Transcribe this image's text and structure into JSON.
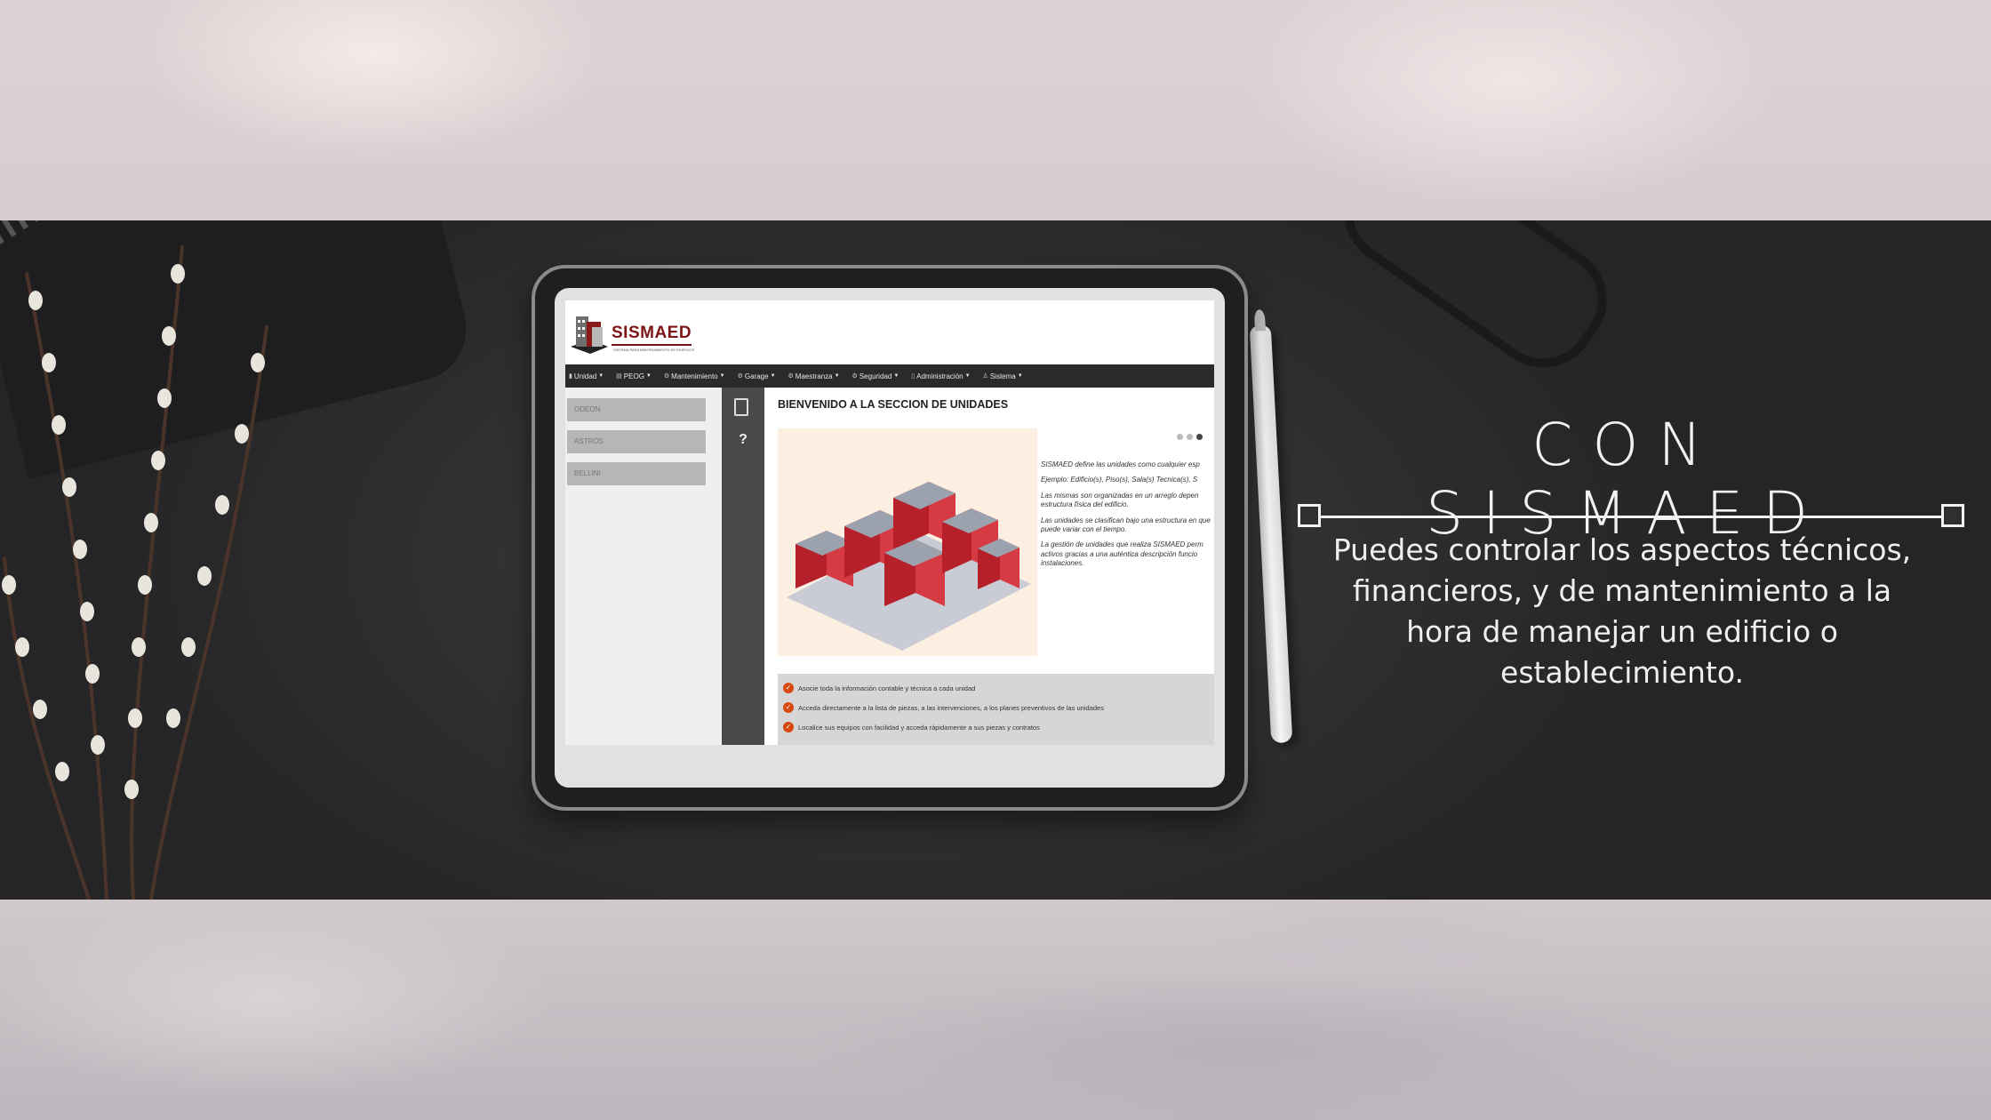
{
  "app": {
    "brand": "SISMAED",
    "brand_sub": "SISTEMA PARA MANTENIMIENTO DE EDIFICIOS",
    "menu": [
      {
        "label": "Unidad",
        "icon": "building-icon"
      },
      {
        "label": "PEOG",
        "icon": "table-icon"
      },
      {
        "label": "Mantenimiento",
        "icon": "gears-icon"
      },
      {
        "label": "Garage",
        "icon": "gears-icon"
      },
      {
        "label": "Maestranza",
        "icon": "gears-icon"
      },
      {
        "label": "Seguridad",
        "icon": "gears-icon"
      },
      {
        "label": "Administración",
        "icon": "book-icon"
      },
      {
        "label": "Sistema",
        "icon": "sitemap-icon"
      }
    ],
    "units": [
      "ODEON",
      "ASTROS",
      "BELLINI"
    ],
    "welcome_title": "BIENVENIDO A LA SECCION DE UNIDADES",
    "description": [
      "SISMAED define las unidades como cualquier esp",
      "Ejemplo: Edificio(s), Piso(s), Sala(s) Tecnica(s), S",
      "Las mismas son organizadas en un arreglo depen estructura física del edificio.",
      "Las unidades se clasifican bajo una estructura en que puede variar con el tiempo.",
      "La gestión de unidades que realiza SISMAED perm activos gracias a una auténtica descripción funcio instalaciones."
    ],
    "features": [
      "Asocie toda la información contable y técnica a cada unidad",
      "Acceda directamente a la lista de piezas, a las intervenciones, a los planes preventivos de las unidades",
      "Localice sus equipos con facilidad y acceda rápidamente a sus piezas y contratos"
    ],
    "carousel_dots": 3,
    "active_dot": 3
  },
  "headline": "CON SISMAED",
  "subtext": "Puedes controlar los aspectos técnicos, financieros, y de mantenimiento a la hora de manejar un edificio o establecimiento.",
  "colors": {
    "brand": "#7c1515",
    "menubar": "#2a2a2a",
    "check": "#d9480f",
    "band": "#2f2f31"
  }
}
